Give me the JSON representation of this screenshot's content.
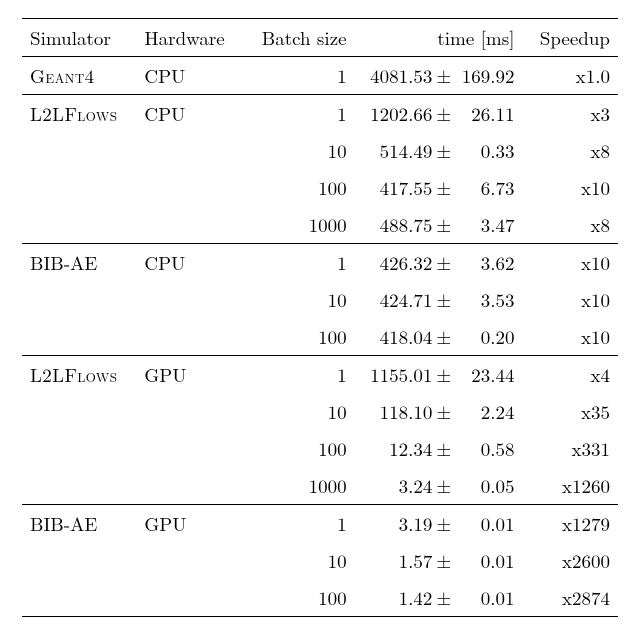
{
  "chart_data": {
    "type": "table",
    "title": "",
    "columns": [
      "Simulator",
      "Hardware",
      "Batch size",
      "time [ms]",
      "Speedup"
    ],
    "groups": [
      {
        "simulator": "Geant4",
        "hardware": "CPU",
        "rows": [
          {
            "batch": 1,
            "time_mean": 4081.53,
            "time_err": 169.92,
            "speedup": "x1.0"
          }
        ]
      },
      {
        "simulator": "L2LFlows",
        "hardware": "CPU",
        "rows": [
          {
            "batch": 1,
            "time_mean": 1202.66,
            "time_err": 26.11,
            "speedup": "x3"
          },
          {
            "batch": 10,
            "time_mean": 514.49,
            "time_err": 0.33,
            "speedup": "x8"
          },
          {
            "batch": 100,
            "time_mean": 417.55,
            "time_err": 6.73,
            "speedup": "x10"
          },
          {
            "batch": 1000,
            "time_mean": 488.75,
            "time_err": 3.47,
            "speedup": "x8"
          }
        ]
      },
      {
        "simulator": "BIB-AE",
        "hardware": "CPU",
        "rows": [
          {
            "batch": 1,
            "time_mean": 426.32,
            "time_err": 3.62,
            "speedup": "x10"
          },
          {
            "batch": 10,
            "time_mean": 424.71,
            "time_err": 3.53,
            "speedup": "x10"
          },
          {
            "batch": 100,
            "time_mean": 418.04,
            "time_err": 0.2,
            "speedup": "x10"
          }
        ]
      },
      {
        "simulator": "L2LFlows",
        "hardware": "GPU",
        "rows": [
          {
            "batch": 1,
            "time_mean": 1155.01,
            "time_err": 23.44,
            "speedup": "x4"
          },
          {
            "batch": 10,
            "time_mean": 118.1,
            "time_err": 2.24,
            "speedup": "x35"
          },
          {
            "batch": 100,
            "time_mean": 12.34,
            "time_err": 0.58,
            "speedup": "x331"
          },
          {
            "batch": 1000,
            "time_mean": 3.24,
            "time_err": 0.05,
            "speedup": "x1260"
          }
        ]
      },
      {
        "simulator": "BIB-AE",
        "hardware": "GPU",
        "rows": [
          {
            "batch": 1,
            "time_mean": 3.19,
            "time_err": 0.01,
            "speedup": "x1279"
          },
          {
            "batch": 10,
            "time_mean": 1.57,
            "time_err": 0.01,
            "speedup": "x2600"
          },
          {
            "batch": 100,
            "time_mean": 1.42,
            "time_err": 0.01,
            "speedup": "x2874"
          }
        ]
      }
    ]
  },
  "headers": {
    "simulator": "Simulator",
    "hardware": "Hardware",
    "batch": "Batch size",
    "time": "time [ms]",
    "speedup": "Speedup"
  },
  "pm": "±"
}
